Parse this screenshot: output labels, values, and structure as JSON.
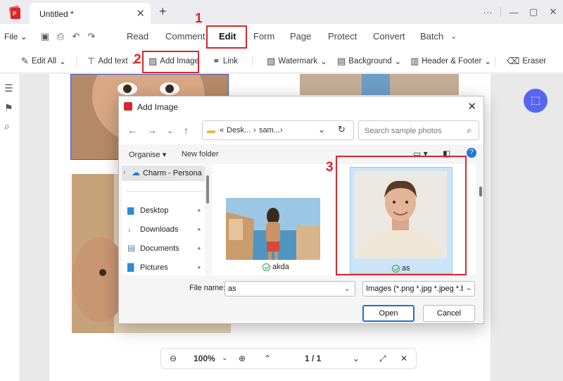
{
  "tab": {
    "title": "Untitled *"
  },
  "window": {
    "more": "···",
    "minimize": "—",
    "maximize": "▢",
    "close": "✕"
  },
  "menubar": {
    "file": "File",
    "items": [
      "Read",
      "Comment",
      "Edit",
      "Form",
      "Page",
      "Protect",
      "Convert",
      "Batch"
    ]
  },
  "toolbar": {
    "edit_all": "Edit All",
    "add_text": "Add text",
    "add_image": "Add Image",
    "link": "Link",
    "watermark": "Watermark",
    "background": "Background",
    "header_footer": "Header & Footer",
    "eraser": "Eraser"
  },
  "annotations": [
    "1",
    "2",
    "3"
  ],
  "zoombar": {
    "zoom": "100%",
    "page": "1 / 1"
  },
  "dialog": {
    "title": "Add Image",
    "path": [
      "Desk...",
      "sam..."
    ],
    "search_placeholder": "Search sample photos",
    "organise": "Organise",
    "new_folder": "New folder",
    "nav_items": [
      {
        "label": "Charm - Persona",
        "icon": "cloud-icon"
      },
      {
        "label": "Desktop",
        "icon": "desktop-folder-icon"
      },
      {
        "label": "Downloads",
        "icon": "downloads-folder-icon"
      },
      {
        "label": "Documents",
        "icon": "documents-folder-icon"
      },
      {
        "label": "Pictures",
        "icon": "pictures-folder-icon"
      }
    ],
    "files": [
      {
        "name": "akda"
      },
      {
        "name": "as"
      }
    ],
    "file_name_label": "File name:",
    "file_name_value": "as",
    "file_type": "Images (*.png *.jpg *.jpeg *.bmp)",
    "open": "Open",
    "cancel": "Cancel"
  },
  "colors": {
    "accent_red": "#d9262c",
    "ai_button": "#5865f2",
    "selection": "#cce4f7"
  }
}
